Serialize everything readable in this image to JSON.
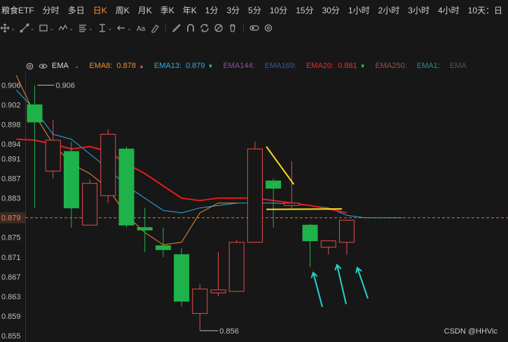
{
  "tabs": [
    {
      "label": "粮食ETF",
      "active": false
    },
    {
      "label": "分时",
      "active": false
    },
    {
      "label": "多日",
      "active": false
    },
    {
      "label": "日K",
      "active": true
    },
    {
      "label": "周K",
      "active": false
    },
    {
      "label": "月K",
      "active": false
    },
    {
      "label": "季K",
      "active": false
    },
    {
      "label": "年K",
      "active": false
    },
    {
      "label": "1分",
      "active": false
    },
    {
      "label": "3分",
      "active": false
    },
    {
      "label": "5分",
      "active": false
    },
    {
      "label": "10分",
      "active": false
    },
    {
      "label": "15分",
      "active": false
    },
    {
      "label": "30分",
      "active": false
    },
    {
      "label": "1小时",
      "active": false
    },
    {
      "label": "2小时",
      "active": false
    },
    {
      "label": "3小时",
      "active": false
    },
    {
      "label": "4小时",
      "active": false
    },
    {
      "label": "10天：日",
      "active": false
    }
  ],
  "tools": [
    "crosshair",
    "trend-line",
    "rectangle",
    "wave",
    "parallel-lines",
    "fib-level",
    "arrow",
    "text",
    "eraser",
    "pen",
    "magnet",
    "sync",
    "hide",
    "delete",
    "visibility",
    "settings"
  ],
  "legend": {
    "indicator": "EMA",
    "items": [
      {
        "name": "EMA8:",
        "value": "0.878",
        "arrow": "▲",
        "color": "#f08c2e",
        "arrow_color": "#e74c4c"
      },
      {
        "name": "EMA13:",
        "value": "0.879",
        "arrow": "▼",
        "color": "#2aaee0",
        "arrow_color": "#2ecc71"
      },
      {
        "name": "EMA144:",
        "value": "",
        "arrow": "",
        "color": "#8e4d9c",
        "arrow_color": ""
      },
      {
        "name": "EMA169:",
        "value": "",
        "arrow": "",
        "color": "#2f5f9a",
        "arrow_color": ""
      },
      {
        "name": "EMA20:",
        "value": "0.881",
        "arrow": "▼",
        "color": "#e63030",
        "arrow_color": "#2ecc71"
      },
      {
        "name": "EMA250:",
        "value": "",
        "arrow": "",
        "color": "#9a4f4f",
        "arrow_color": ""
      },
      {
        "name": "EMA1:",
        "value": "",
        "arrow": "",
        "color": "#2a8a8a",
        "arrow_color": ""
      },
      {
        "name": "EMA",
        "value": "",
        "arrow": "",
        "color": "#555555",
        "arrow_color": ""
      }
    ]
  },
  "watermark": "CSDN @HHVic",
  "chart_data": {
    "type": "candlestick",
    "y_ticks": [
      "0.906",
      "0.902",
      "0.898",
      "0.894",
      "0.891",
      "0.887",
      "0.883",
      "0.879",
      "0.875",
      "0.871",
      "0.867",
      "0.863",
      "0.859",
      "0.855"
    ],
    "ylim": [
      0.8537,
      0.9085
    ],
    "current_price": "0.879",
    "current_price_value": 0.879,
    "high_label": "0.906",
    "high_value": 0.906,
    "low_label": "0.856",
    "low_value": 0.856,
    "colors": {
      "up": "#e74c4c",
      "down": "#1fb24a",
      "ema8": "#f08c2e",
      "ema13": "#2aaee0",
      "ema20": "#e61c1c",
      "current": "#e8703a",
      "yellow": "#f5e11c",
      "arrow": "#2ad0c8"
    },
    "candles": [
      {
        "open": 0.902,
        "close": 0.8985,
        "high": 0.906,
        "low": 0.881
      },
      {
        "open": 0.8885,
        "close": 0.8948,
        "high": 0.899,
        "low": 0.887
      },
      {
        "open": 0.8925,
        "close": 0.881,
        "high": 0.8945,
        "low": 0.877
      },
      {
        "open": 0.8775,
        "close": 0.886,
        "high": 0.8868,
        "low": 0.8775
      },
      {
        "open": 0.8835,
        "close": 0.896,
        "high": 0.897,
        "low": 0.882
      },
      {
        "open": 0.893,
        "close": 0.8775,
        "high": 0.8935,
        "low": 0.877
      },
      {
        "open": 0.877,
        "close": 0.8765,
        "high": 0.881,
        "low": 0.872
      },
      {
        "open": 0.8733,
        "close": 0.8725,
        "high": 0.877,
        "low": 0.871
      },
      {
        "open": 0.8715,
        "close": 0.862,
        "high": 0.8728,
        "low": 0.861
      },
      {
        "open": 0.8595,
        "close": 0.8645,
        "high": 0.8655,
        "low": 0.856
      },
      {
        "open": 0.8637,
        "close": 0.8643,
        "high": 0.872,
        "low": 0.863
      },
      {
        "open": 0.864,
        "close": 0.874,
        "high": 0.8745,
        "low": 0.864
      },
      {
        "open": 0.874,
        "close": 0.893,
        "high": 0.8945,
        "low": 0.874
      },
      {
        "open": 0.8865,
        "close": 0.885,
        "high": 0.887,
        "low": 0.877
      },
      {
        "open": 0.8815,
        "close": 0.882,
        "high": 0.8905,
        "low": 0.881
      },
      {
        "open": 0.8775,
        "close": 0.8743,
        "high": 0.8778,
        "low": 0.869
      },
      {
        "open": 0.873,
        "close": 0.8743,
        "high": 0.8743,
        "low": 0.8715
      },
      {
        "open": 0.874,
        "close": 0.8785,
        "high": 0.8785,
        "low": 0.8715
      }
    ],
    "ema8": [
      0.908,
      0.9,
      0.894,
      0.89,
      0.888,
      0.885,
      0.8795,
      0.876,
      0.8735,
      0.874,
      0.88,
      0.882,
      0.882
    ],
    "ema13": [
      0.905,
      0.901,
      0.896,
      0.895,
      0.892,
      0.889,
      0.8855,
      0.883,
      0.8805,
      0.88,
      0.881,
      0.8815,
      0.882,
      0.882,
      0.882,
      0.8818,
      0.8815,
      0.881,
      0.8795,
      0.879,
      0.879,
      0.879
    ],
    "ema20": [
      0.895,
      0.8948,
      0.894,
      0.893,
      0.8935,
      0.8925,
      0.89,
      0.888,
      0.8855,
      0.883,
      0.8825,
      0.883,
      0.883,
      0.883,
      0.8825,
      0.882,
      0.8815,
      0.8808,
      0.88
    ]
  }
}
